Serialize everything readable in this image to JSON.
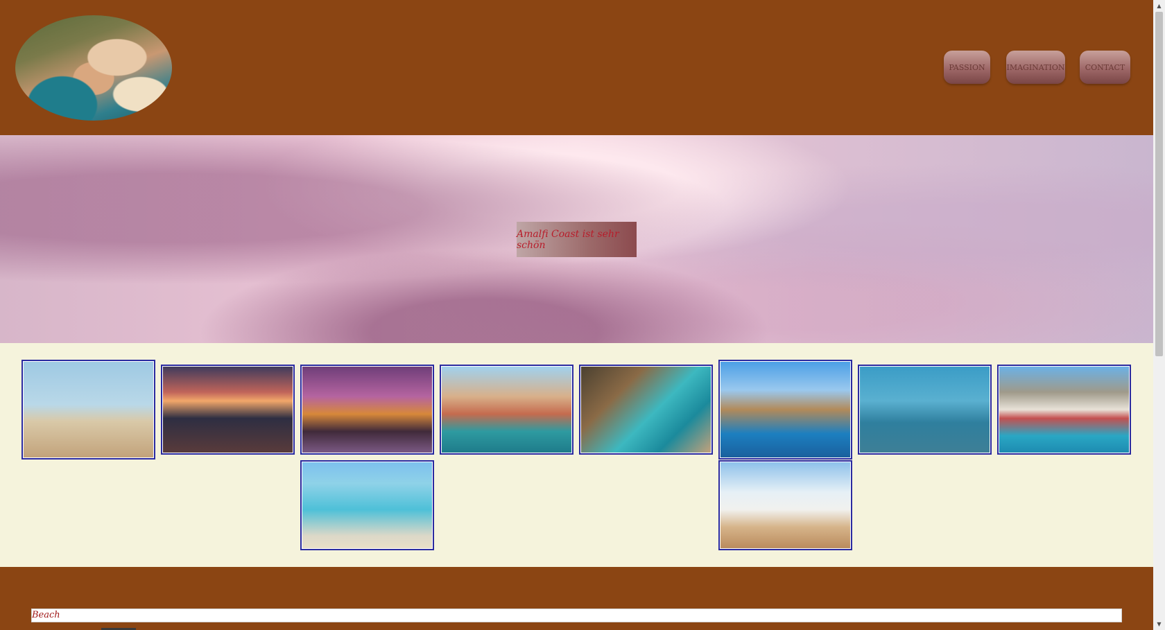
{
  "header": {
    "logo_alt": "Amalfi Coast",
    "nav": [
      "PASSION",
      "IMAGINATION",
      "CONTACT"
    ]
  },
  "hero": {
    "label": "Amalfi Coast ist sehr schön"
  },
  "gallery": {
    "items": [
      {
        "name": "beach-chairs-image"
      },
      {
        "name": "vernazza-sunset-image"
      },
      {
        "name": "venice-canal-night-image"
      },
      {
        "name": "venice-grand-canal-image"
      },
      {
        "name": "rocky-cove-image"
      },
      {
        "name": "manarola-cliff-image"
      },
      {
        "name": "ferry-harbor-image"
      },
      {
        "name": "capri-marina-image"
      },
      {
        "name": "woman-in-sea-image"
      },
      {
        "name": "family-beach-image"
      }
    ]
  },
  "footer": {
    "field_value": "Beach"
  },
  "colors": {
    "header_bg": "#8b4513",
    "content_bg": "#f5f3dc",
    "thumb_border": "#2a2aa0",
    "hero_text": "#b81c2a"
  }
}
